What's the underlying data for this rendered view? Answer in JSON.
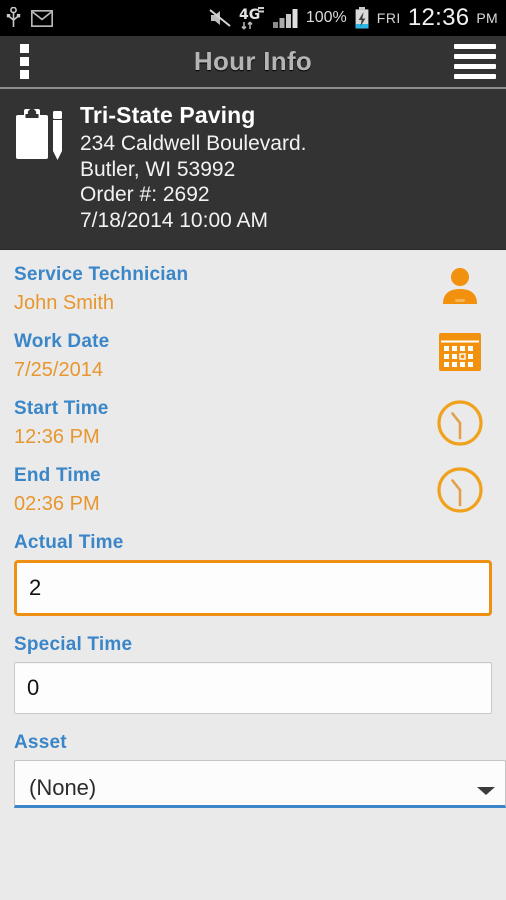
{
  "statusbar": {
    "left_icons": [
      "usb-icon",
      "gmail-icon"
    ],
    "right_icons": [
      "mute-icon",
      "4g-lte-icon",
      "signal-bars-icon",
      "battery-charging-icon"
    ],
    "network_label": "4G",
    "battery_percent": "100%",
    "day": "FRI",
    "time": "12:36",
    "ampm": "PM"
  },
  "actionbar": {
    "overflow_icon": "overflow-menu-icon",
    "title": "Hour Info",
    "menu_icon": "hamburger-menu-icon"
  },
  "order_header": {
    "icon": "clipboard-pencil-icon",
    "company": "Tri-State Paving",
    "address_line1": "234 Caldwell Boulevard.",
    "address_line2": "Butler, WI 53992",
    "order_number": "Order #: 2692",
    "order_datetime": "7/18/2014 10:00 AM"
  },
  "form": {
    "service_technician": {
      "label": "Service Technician",
      "value": "John Smith",
      "icon": "person-icon"
    },
    "work_date": {
      "label": "Work Date",
      "value": "7/25/2014",
      "icon": "calendar-icon"
    },
    "start_time": {
      "label": "Start Time",
      "value": "12:36 PM",
      "icon": "clock-icon"
    },
    "end_time": {
      "label": "End Time",
      "value": "02:36 PM",
      "icon": "clock-icon"
    },
    "actual_time": {
      "label": "Actual Time",
      "value": "2",
      "placeholder": ""
    },
    "special_time": {
      "label": "Special Time",
      "value": "0",
      "placeholder": ""
    },
    "asset": {
      "label": "Asset",
      "value": "(None)",
      "caret_icon": "dropdown-caret-icon"
    }
  },
  "colors": {
    "accent_orange": "#ef8f13",
    "value_orange": "#e8962e",
    "label_blue": "#3a86c8",
    "header_dark": "#333333",
    "page_background": "#eaeaea"
  }
}
